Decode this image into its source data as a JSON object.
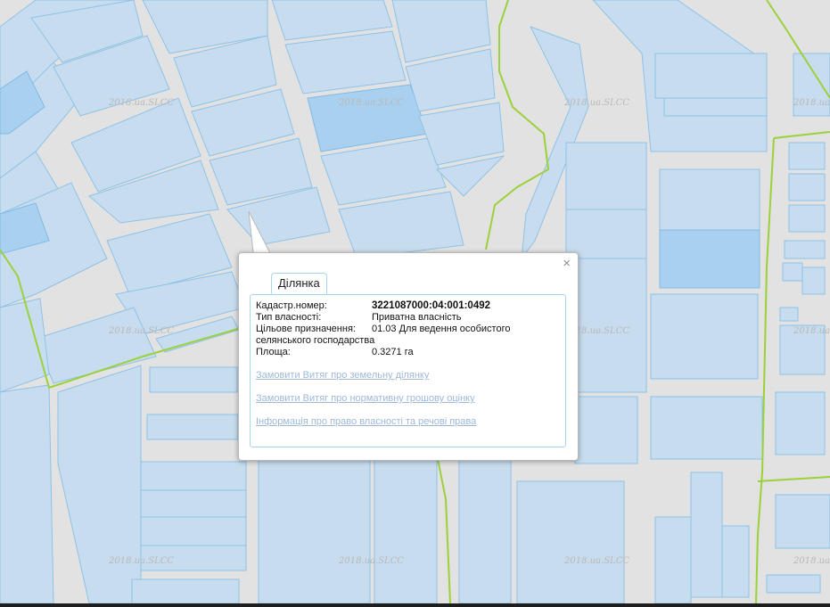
{
  "map": {
    "watermark": "2018.ua.SLCC",
    "colors": {
      "background": "#e2e2e2",
      "parcel": "#c7dcee",
      "parcel_border": "#8ec2e8",
      "boundary": "#9bd13a"
    }
  },
  "popup": {
    "tab_label": "Ділянка",
    "close_icon": "×",
    "fields": [
      {
        "label": "Кадастр.номер:",
        "value": "3221087000:04:001:0492"
      },
      {
        "label": "Тип власності:",
        "value": "Приватна власність"
      },
      {
        "label": "Цільове призначення:",
        "value": "01.03 Для ведення особистого"
      },
      {
        "label": "",
        "value": "селянського господарства"
      },
      {
        "label": "Площа:",
        "value": "0.3271 га"
      }
    ],
    "links": [
      "Замовити Витяг про земельну ділянку",
      "Замовити Витяг про нормативну грошову оцінку",
      "Інформація про право власності та речові права"
    ]
  }
}
